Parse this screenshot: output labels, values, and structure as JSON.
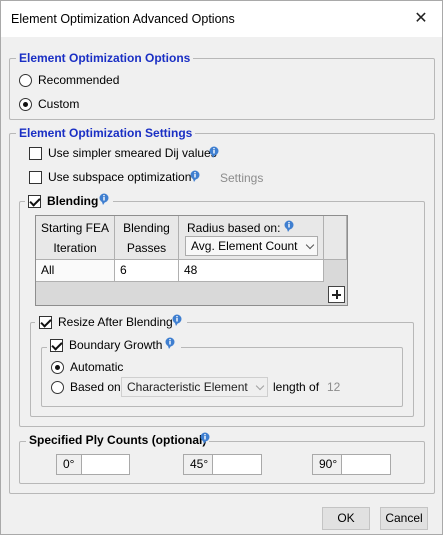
{
  "window": {
    "title": "Element Optimization Advanced Options",
    "close_symbol": "✕"
  },
  "options_group": {
    "title": "Element Optimization Options",
    "recommended_label": "Recommended",
    "custom_label": "Custom",
    "selected": "Custom"
  },
  "settings_group": {
    "title": "Element Optimization Settings",
    "smeared_label": "Use simpler smeared Dij values",
    "smeared_checked": false,
    "subspace_label": "Use subspace optimization",
    "subspace_checked": false,
    "settings_button": "Settings"
  },
  "blending": {
    "label": "Blending",
    "checked": true,
    "table": {
      "col_starting_line1": "Starting FEA",
      "col_starting_line2": "Iteration",
      "col_passes_line1": "Blending",
      "col_passes_line2": "Passes",
      "col_radius_label": "Radius based on:",
      "radius_option": "Avg. Element Count",
      "row": {
        "iteration": "All",
        "passes": "6",
        "radius": "48"
      }
    },
    "resize": {
      "label": "Resize After Blending",
      "checked": true,
      "boundary": {
        "label": "Boundary Growth",
        "checked": true,
        "automatic_label": "Automatic",
        "based_on_label": "Based on",
        "based_on_option": "Characteristic Element",
        "length_of_label": "length of",
        "length_value": "12",
        "selected": "Automatic"
      }
    }
  },
  "ply_counts": {
    "title": "Specified Ply Counts (optional)",
    "angles": [
      "0°",
      "45°",
      "90°"
    ],
    "values": [
      "",
      "",
      ""
    ]
  },
  "buttons": {
    "ok": "OK",
    "cancel": "Cancel"
  },
  "colors": {
    "group_title_blue": "#1a2fc4",
    "info_icon_blue": "#3f7fd0"
  }
}
